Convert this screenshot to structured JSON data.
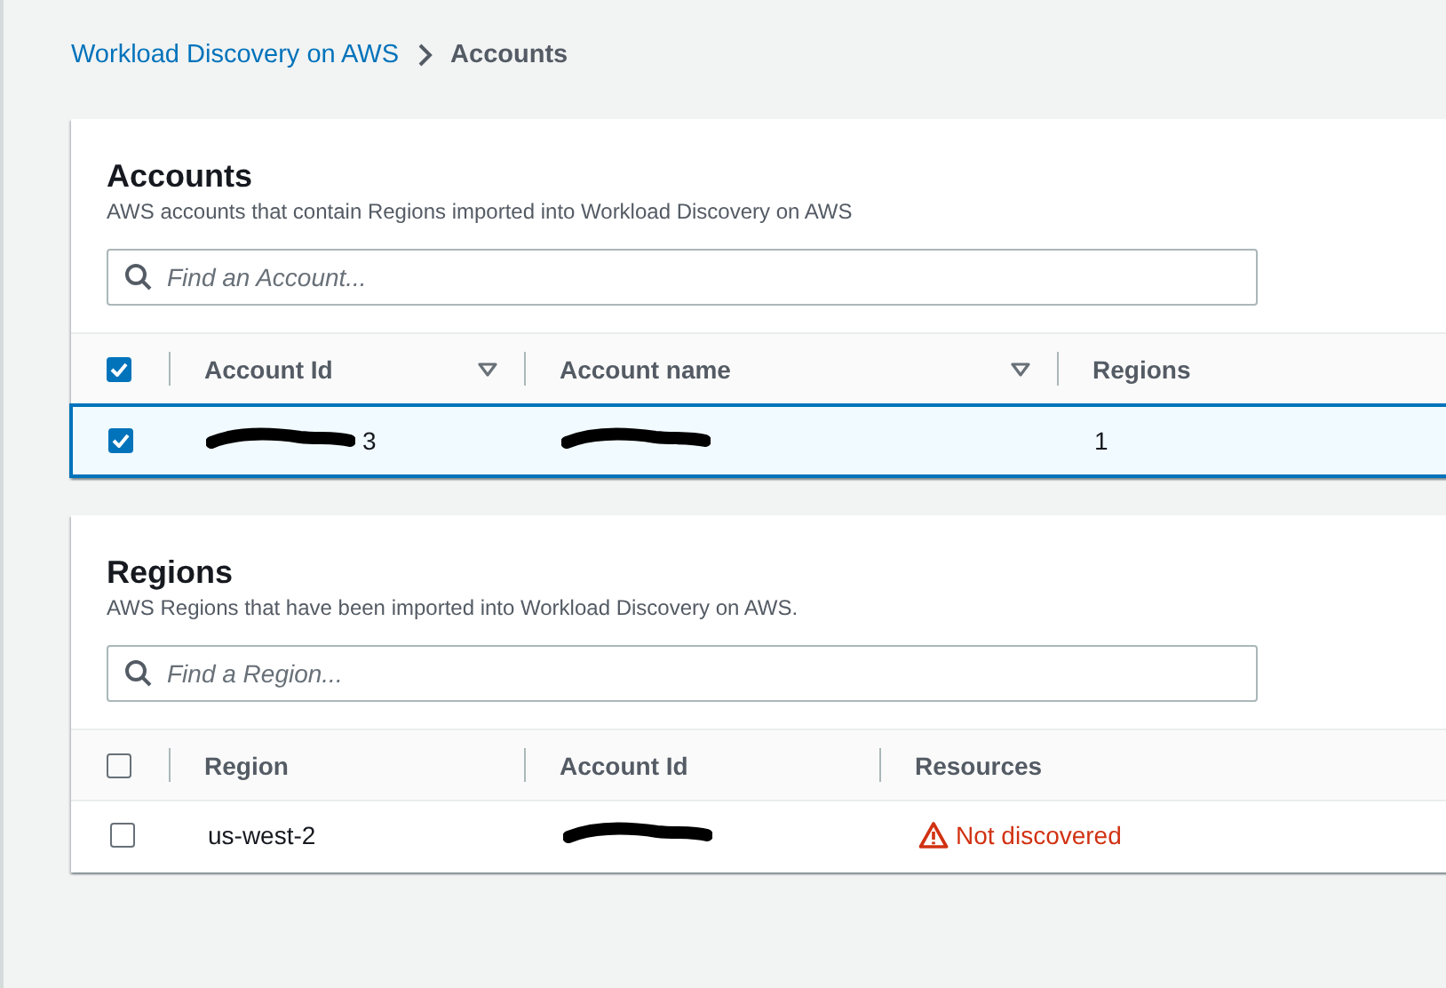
{
  "breadcrumbs": [
    {
      "label": "Workload Discovery on AWS",
      "kind": "link"
    },
    {
      "label": "Accounts",
      "kind": "current"
    }
  ],
  "accounts": {
    "title": "Accounts",
    "description": "AWS accounts that contain Regions imported into Workload Discovery on AWS",
    "search": {
      "placeholder": "Find an Account..."
    },
    "select_all": {
      "checked": true
    },
    "columns": [
      {
        "label": "Account Id",
        "sortable": true
      },
      {
        "label": "Account name",
        "sortable": true
      },
      {
        "label": "Regions",
        "sortable": false
      }
    ],
    "rows": [
      {
        "selected": true,
        "cells": [
          {
            "text": "3",
            "redacted": true
          },
          {
            "text": "",
            "redacted": true
          },
          {
            "text": "1",
            "redacted": false
          }
        ]
      }
    ]
  },
  "regions": {
    "title": "Regions",
    "description": "AWS Regions that have been imported into Workload Discovery on AWS.",
    "search": {
      "placeholder": "Find a Region..."
    },
    "select_all": {
      "checked": false
    },
    "columns": [
      {
        "label": "Region",
        "sortable": false
      },
      {
        "label": "Account Id",
        "sortable": false
      },
      {
        "label": "Resources",
        "sortable": false
      }
    ],
    "rows": [
      {
        "selected": false,
        "cells": [
          {
            "text": "us-west-2",
            "redacted": false,
            "kind": "plain"
          },
          {
            "text": "",
            "redacted": true
          },
          {
            "text": "Not discovered",
            "redacted": false,
            "kind": "warning"
          }
        ]
      }
    ]
  }
}
